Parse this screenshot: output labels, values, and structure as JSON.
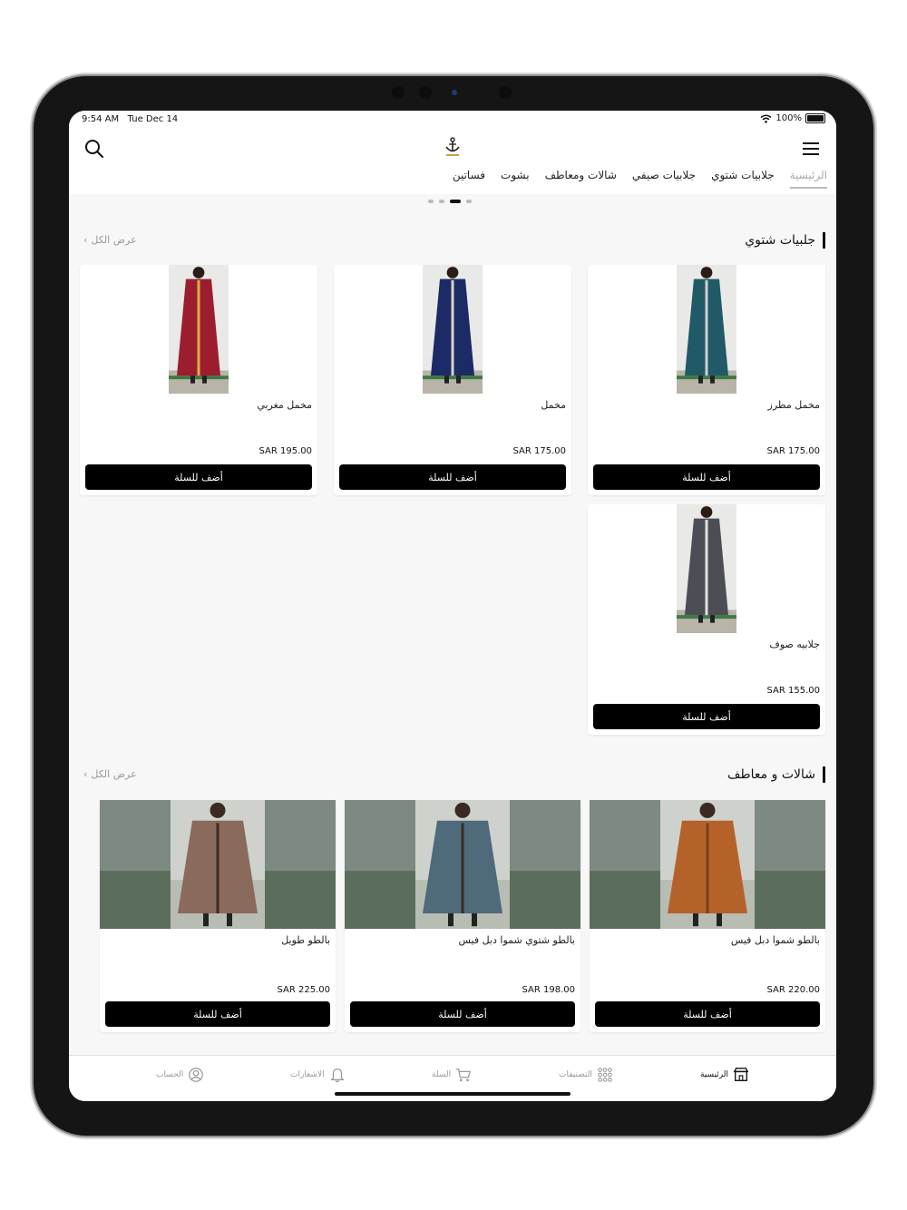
{
  "status": {
    "time": "9:54 AM",
    "date": "Tue Dec 14",
    "battery": "100%"
  },
  "tabs": [
    {
      "label": "الرئيسية",
      "active": true
    },
    {
      "label": "جلابيات شتوي",
      "active": false
    },
    {
      "label": "جلابيات صيفي",
      "active": false
    },
    {
      "label": "شالات ومعاطف",
      "active": false
    },
    {
      "label": "بشوت",
      "active": false
    },
    {
      "label": "فساتين",
      "active": false
    }
  ],
  "carousel": {
    "page_count": 4,
    "active_index": 2
  },
  "sections": [
    {
      "title": "جلبيات شتوي",
      "view_all": "عرض الكل",
      "products": [
        {
          "name": "مخمل مطرز",
          "price": "SAR 175.00",
          "add_label": "أضف للسلة",
          "dress_color": "#1f5a66",
          "trim_color": "#cfcfcf"
        },
        {
          "name": "مخمل",
          "price": "SAR 175.00",
          "add_label": "أضف للسلة",
          "dress_color": "#1c2b66",
          "trim_color": "#d9d4c4"
        },
        {
          "name": "مخمل مغربي",
          "price": "SAR 195.00",
          "add_label": "أضف للسلة",
          "dress_color": "#9c1e2e",
          "trim_color": "#d7b24a"
        },
        {
          "name": "جلابيه صوف",
          "price": "SAR 155.00",
          "add_label": "أضف للسلة",
          "dress_color": "#4b4f55",
          "trim_color": "#e0e0e0"
        }
      ]
    },
    {
      "title": "شالات و معاطف",
      "view_all": "عرض الكل",
      "products": [
        {
          "name": "بالطو شموا دبل فيس",
          "price": "SAR 220.00",
          "add_label": "أضف للسلة",
          "dress_color": "#b5622a",
          "trim_color": "#7a3d1a"
        },
        {
          "name": "بالطو شتوي شموا دبل فيس",
          "price": "SAR 198.00",
          "add_label": "أضف للسلة",
          "dress_color": "#4f6a7a",
          "trim_color": "#3a2a22"
        },
        {
          "name": "بالطو طويل",
          "price": "SAR 225.00",
          "add_label": "أضف للسلة",
          "dress_color": "#8a6a5a",
          "trim_color": "#3b2a2a"
        }
      ]
    }
  ],
  "bottom_nav": [
    {
      "label": "الرئيسية",
      "icon": "store-icon",
      "active": true
    },
    {
      "label": "التصنيفات",
      "icon": "grid-icon",
      "active": false
    },
    {
      "label": "السلة",
      "icon": "cart-icon",
      "active": false
    },
    {
      "label": "الاشعارات",
      "icon": "bell-icon",
      "active": false
    },
    {
      "label": "الحساب",
      "icon": "user-icon",
      "active": false
    }
  ]
}
